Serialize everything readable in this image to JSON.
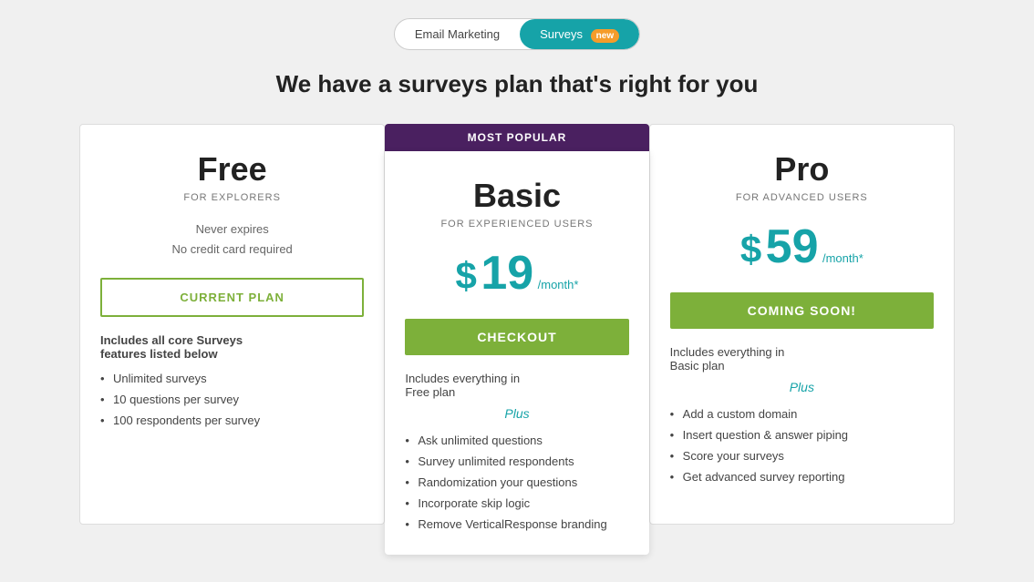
{
  "toggle": {
    "email_label": "Email Marketing",
    "surveys_label": "Surveys",
    "surveys_badge": "new"
  },
  "headline": "We have a surveys plan that's right for you",
  "plans": [
    {
      "id": "free",
      "name": "Free",
      "subtitle": "FOR EXPLORERS",
      "never_expires": "Never expires",
      "no_credit_card": "No credit card required",
      "btn_label": "CURRENT PLAN",
      "btn_type": "current",
      "includes_line1": "Includes all core Surveys",
      "includes_line2": "features listed below",
      "features": [
        "Unlimited surveys",
        "10 questions per survey",
        "100 respondents per survey"
      ]
    },
    {
      "id": "basic",
      "name": "Basic",
      "subtitle": "FOR EXPERIENCED USERS",
      "price_dollar": "$",
      "price_amount": "19",
      "price_period": "/month*",
      "btn_label": "CHECKOUT",
      "btn_type": "checkout",
      "most_popular": "MOST POPULAR",
      "includes_line1": "Includes everything in",
      "includes_line2": "Free plan",
      "plus_label": "Plus",
      "features": [
        "Ask unlimited questions",
        "Survey unlimited respondents",
        "Randomization your questions",
        "Incorporate skip logic",
        "Remove VerticalResponse branding"
      ]
    },
    {
      "id": "pro",
      "name": "Pro",
      "subtitle": "FOR ADVANCED USERS",
      "price_dollar": "$",
      "price_amount": "59",
      "price_period": "/month*",
      "btn_label": "COMING SOON!",
      "btn_type": "coming-soon",
      "includes_line1": "Includes everything in",
      "includes_line2": "Basic plan",
      "plus_label": "Plus",
      "features": [
        "Add a custom domain",
        "Insert question & answer piping",
        "Score your surveys",
        "Get advanced survey reporting"
      ]
    }
  ]
}
